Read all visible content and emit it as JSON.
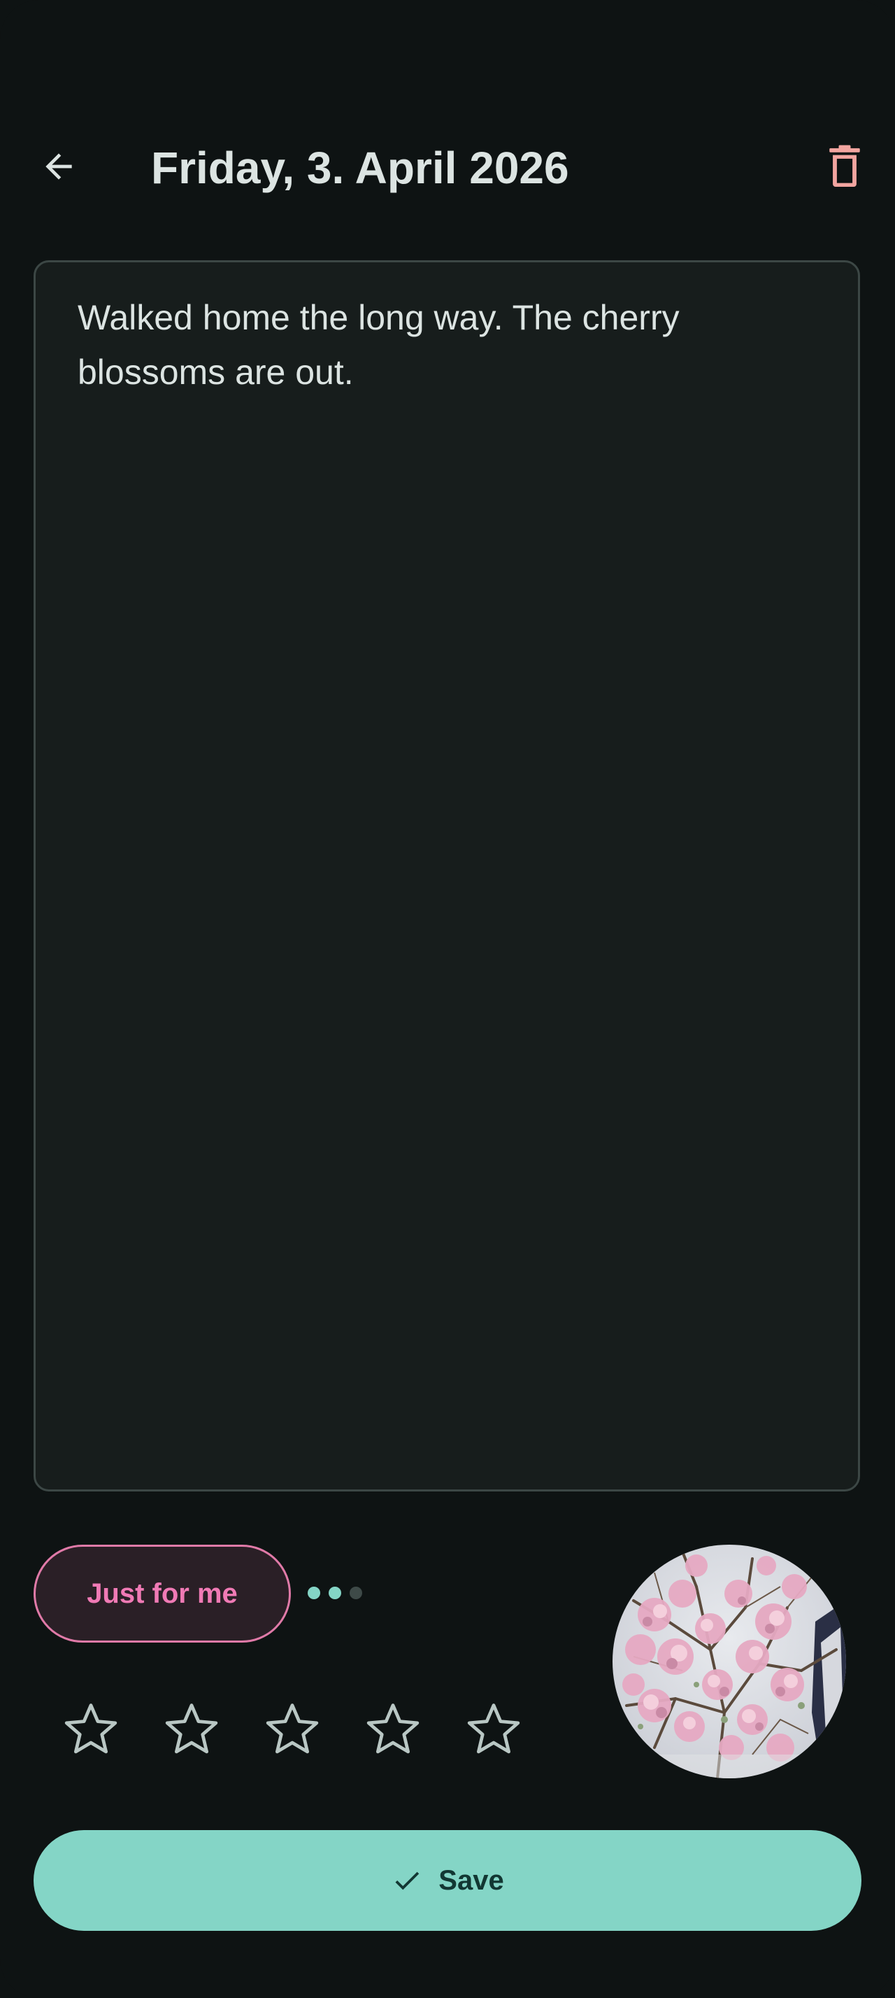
{
  "header": {
    "title": "Friday, 3. April 2026",
    "back_icon": "arrow-back-icon",
    "delete_icon": "trash-icon"
  },
  "entry": {
    "text": "Walked home the long way. The cherry blossoms are out."
  },
  "visibility_chip": {
    "label": "Just for me"
  },
  "pager": {
    "total": 3,
    "active": [
      1,
      2
    ]
  },
  "rating": {
    "max": 5,
    "value": 0
  },
  "photo": {
    "subject": "cherry-blossom-photo"
  },
  "actions": {
    "save_label": "Save",
    "save_icon": "check-icon"
  },
  "colors": {
    "background": "#0e1313",
    "surface": "#171d1c",
    "accent": "#84d5c6",
    "chip_pink": "#f07ab5",
    "delete_red": "#f2a5a0"
  }
}
